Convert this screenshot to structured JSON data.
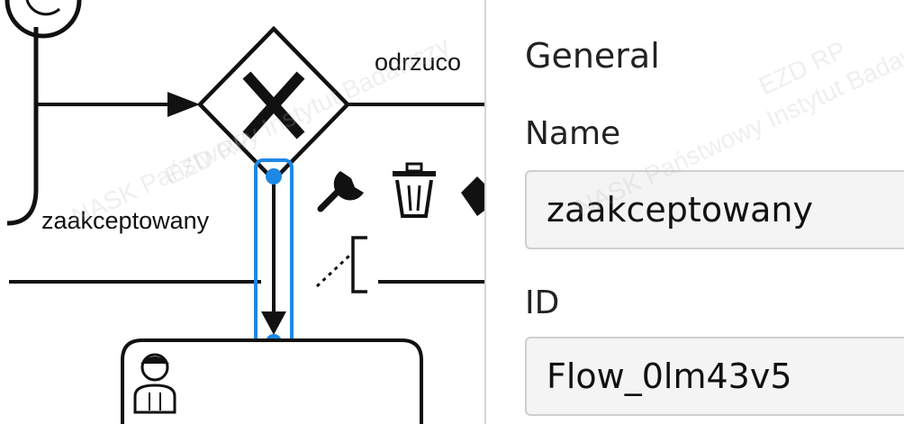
{
  "canvas": {
    "flow_label_accepted": "zaakceptowany",
    "flow_label_rejected": "odrzuco",
    "context_pad": {
      "wrench_icon": "wrench-icon",
      "trash_icon": "trash-icon",
      "color_icon": "color-fill-icon"
    },
    "selection_color": "#1e88e5"
  },
  "watermark": {
    "text_1": "NASK Państwowy Instytut Badawczy",
    "text_2": "EZD RP"
  },
  "properties_panel": {
    "section_title": "General",
    "name_label": "Name",
    "name_value": "zaakceptowany",
    "id_label": "ID",
    "id_value": "Flow_0lm43v5"
  }
}
